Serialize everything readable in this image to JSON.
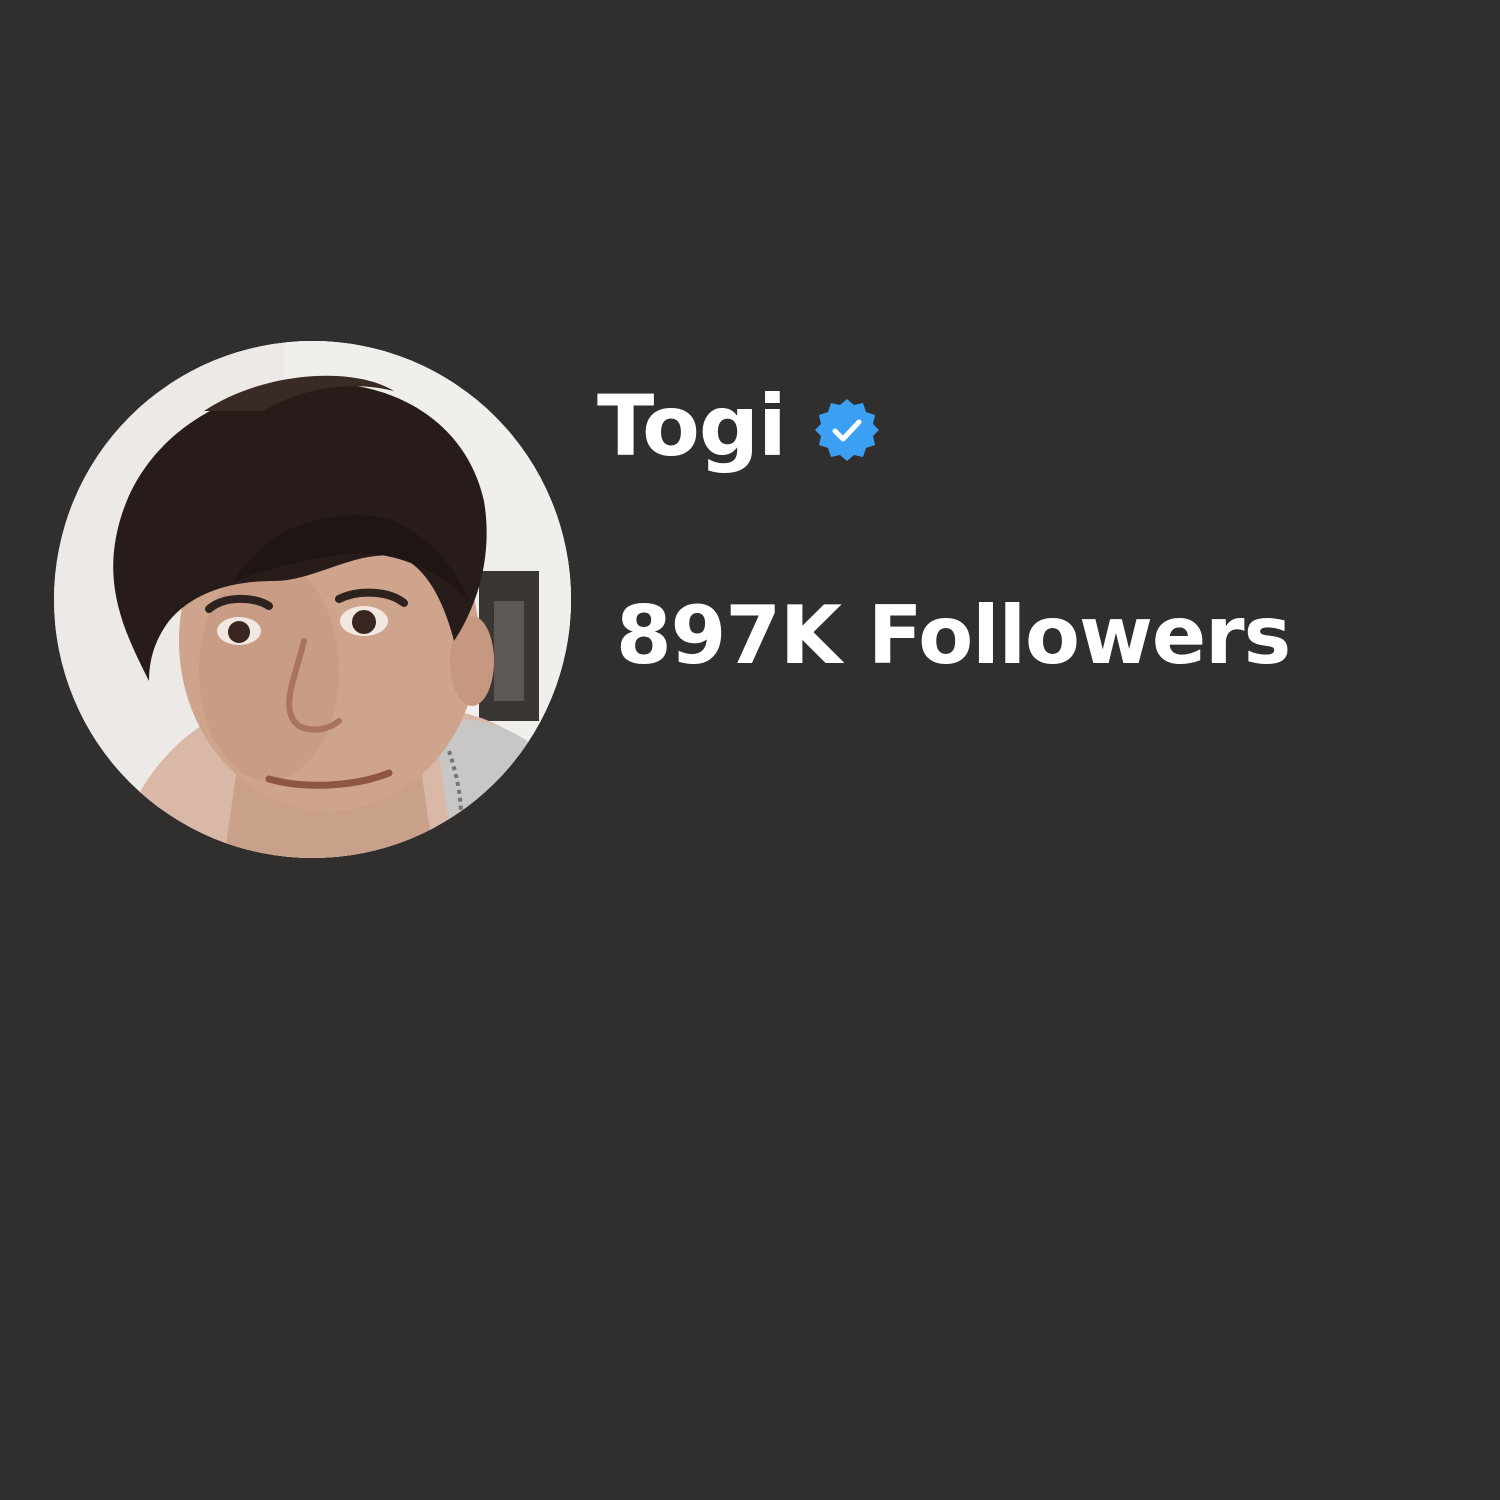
{
  "profile": {
    "name": "Togi",
    "verified": true,
    "verified_icon": "verified-badge-icon",
    "followers_text": "897K Followers",
    "avatar_icon": "profile-photo"
  },
  "colors": {
    "background": "#312f2e",
    "text": "#ffffff",
    "verified_badge": "#3b9ff3"
  }
}
